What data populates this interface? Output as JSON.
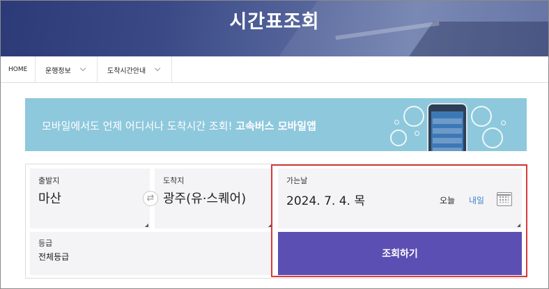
{
  "hero": {
    "title": "시간표조회"
  },
  "nav": {
    "home": "HOME",
    "items": [
      {
        "label": "운행정보"
      },
      {
        "label": "도착시간안내"
      }
    ]
  },
  "banner": {
    "text": "모바일에서도 언제 어디서나 도착시간 조회!",
    "bold_text": "고속버스 모바일앱"
  },
  "form": {
    "departure": {
      "label": "출발지",
      "value": "마산"
    },
    "arrival": {
      "label": "도착지",
      "value": "광주(유·스퀘어)"
    },
    "date": {
      "label": "가는날",
      "value": "2024. 7. 4. 목",
      "today": "오늘",
      "tomorrow": "내일"
    },
    "grade": {
      "label": "등급",
      "value": "전체등급"
    },
    "search_button": "조회하기",
    "swap_icon": "⇄"
  },
  "colors": {
    "primary_button": "#5b4fb4",
    "banner": "#8ec8dc",
    "highlight": "#d83a3a",
    "link": "#3a84d0"
  },
  "icons": [
    "chevron-down-icon",
    "swap-icon",
    "calendar-icon",
    "phone-illustration"
  ]
}
